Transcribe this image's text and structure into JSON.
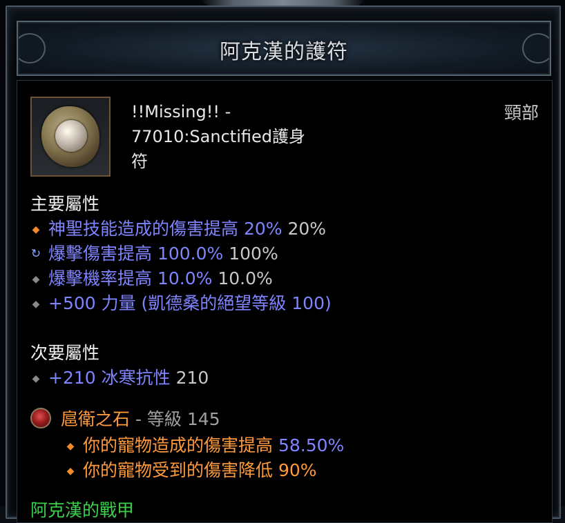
{
  "tooltip": {
    "title": "阿克漢的護符",
    "item_name_line1": "!!Missing!! -",
    "item_name_line2": "77010:Sanctified護身",
    "item_name_line3": "符",
    "slot": "頸部"
  },
  "primary": {
    "heading": "主要屬性",
    "stats": [
      {
        "text": "神聖技能造成的傷害提高 20%",
        "extra": " 20%"
      },
      {
        "text": "爆擊傷害提高 100.0%",
        "extra": " 100%"
      },
      {
        "text": "爆擊機率提高 10.0%",
        "extra": " 10.0%"
      },
      {
        "text": "+500 力量 (凱德桑的絕望等級 100)",
        "extra": ""
      }
    ]
  },
  "secondary": {
    "heading": "次要屬性",
    "stats": [
      {
        "text": "+210 冰寒抗性",
        "extra": " 210"
      }
    ]
  },
  "gem": {
    "name": "扈衛之石",
    "level_text": " - 等級 145",
    "effects": [
      {
        "text": "你的寵物造成的傷害提高 ",
        "value": "58.50%"
      },
      {
        "text": "你的寵物受到的傷害降低 90%",
        "value": ""
      }
    ]
  },
  "set": {
    "partial_text": "阿克漢的戰甲"
  },
  "colors": {
    "magic_blue": "#7f84ff",
    "legendary_orange": "#ff9a3c",
    "set_green": "#3bd04b"
  }
}
